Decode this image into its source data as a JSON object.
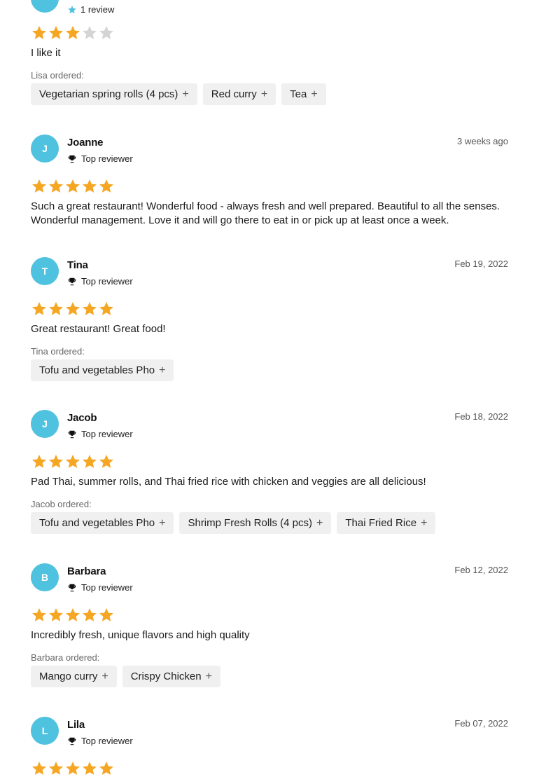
{
  "colors": {
    "accent": "#4ec2df",
    "star_filled": "#f5a623",
    "star_empty": "#d4d4d4",
    "chip_bg": "#f0f0f1"
  },
  "top_partial_review": {
    "review_count": "1 review",
    "rating": 3,
    "text": "I like it",
    "ordered_label": "Lisa ordered:",
    "items": [
      "Vegetarian spring rolls (4 pcs)",
      "Red curry",
      "Tea"
    ]
  },
  "reviews": [
    {
      "initial": "J",
      "name": "Joanne",
      "badge": "Top reviewer",
      "date": "3 weeks ago",
      "rating": 5,
      "text": "Such a great restaurant! Wonderful food - always fresh and well prepared. Beautiful to all the senses. Wonderful management. Love it and will go there to eat in or pick up at least once a week."
    },
    {
      "initial": "T",
      "name": "Tina",
      "badge": "Top reviewer",
      "date": "Feb 19, 2022",
      "rating": 5,
      "text": "Great restaurant! Great food!",
      "ordered_label": "Tina ordered:",
      "items": [
        "Tofu and vegetables Pho"
      ]
    },
    {
      "initial": "J",
      "name": "Jacob",
      "badge": "Top reviewer",
      "date": "Feb 18, 2022",
      "rating": 5,
      "text": "Pad Thai, summer rolls, and Thai fried rice with chicken and veggies are all delicious!",
      "ordered_label": "Jacob ordered:",
      "items": [
        "Tofu and vegetables Pho",
        "Shrimp Fresh Rolls (4 pcs)",
        "Thai Fried Rice"
      ]
    },
    {
      "initial": "B",
      "name": "Barbara",
      "badge": "Top reviewer",
      "date": "Feb 12, 2022",
      "rating": 5,
      "text": "Incredibly fresh, unique flavors and high quality",
      "ordered_label": "Barbara ordered:",
      "items": [
        "Mango curry",
        "Crispy Chicken"
      ]
    },
    {
      "initial": "L",
      "name": "Lila",
      "badge": "Top reviewer",
      "date": "Feb 07, 2022",
      "rating": 5
    }
  ],
  "icons": {
    "star": "star-icon",
    "trophy": "trophy-icon",
    "add": "plus-icon"
  },
  "plus_glyph": "+"
}
